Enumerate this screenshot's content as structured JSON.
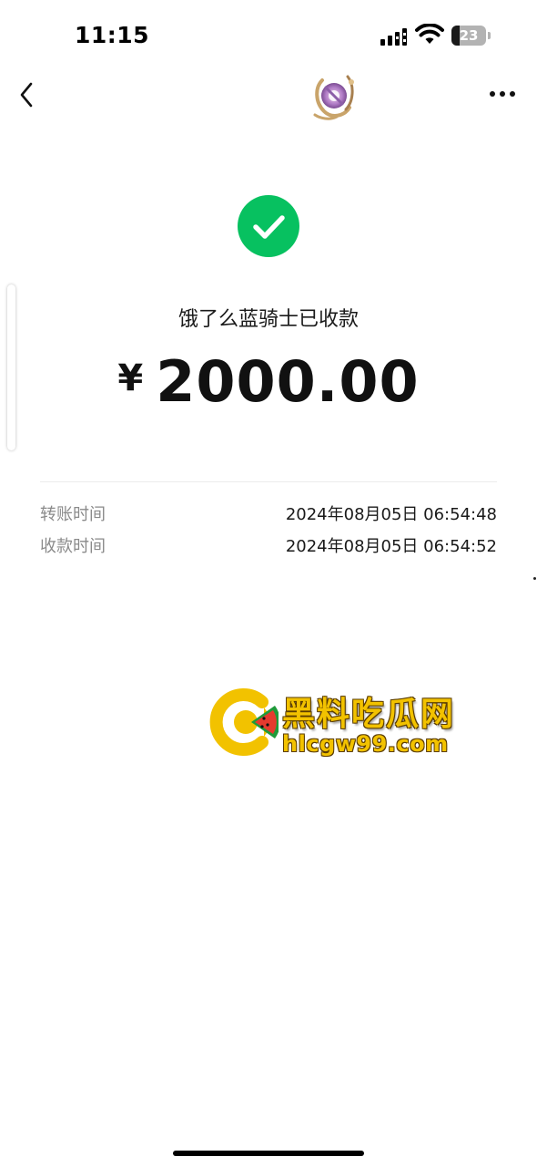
{
  "status_bar": {
    "time": "11:15",
    "battery_level": "23",
    "battery_fraction": 0.23
  },
  "nav": {
    "back_icon": "chevron-left-icon",
    "more_icon": "ellipsis-icon",
    "avatar_icon": "avatar-emblem"
  },
  "receipt": {
    "status_icon": "check-circle-icon",
    "status_color": "#07c160",
    "title": "饿了么蓝骑士已收款",
    "currency": "¥",
    "amount": "2000.00"
  },
  "details": [
    {
      "label": "转账时间",
      "value": "2024年08月05日 06:54:48"
    },
    {
      "label": "收款时间",
      "value": "2024年08月05日 06:54:52"
    }
  ],
  "watermark": {
    "title": "黑料吃瓜网",
    "url": "hlcgw99.com",
    "color": "#f2c200"
  }
}
